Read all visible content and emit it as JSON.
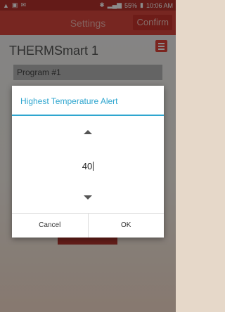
{
  "status": {
    "left_icons": [
      "alert-icon",
      "image-icon",
      "mail-icon"
    ],
    "battery": "55%",
    "time": "10:06 AM"
  },
  "header": {
    "title": "Settings",
    "confirm_label": "Confirm"
  },
  "device": {
    "name": "THERMSmart 1"
  },
  "program": {
    "selected": "Program #1"
  },
  "dialog": {
    "title": "Highest Temperature Alert",
    "value": "40",
    "cancel_label": "Cancel",
    "ok_label": "OK"
  },
  "colors": {
    "accent": "#2fa6cf",
    "header_red": "#d9453c"
  }
}
